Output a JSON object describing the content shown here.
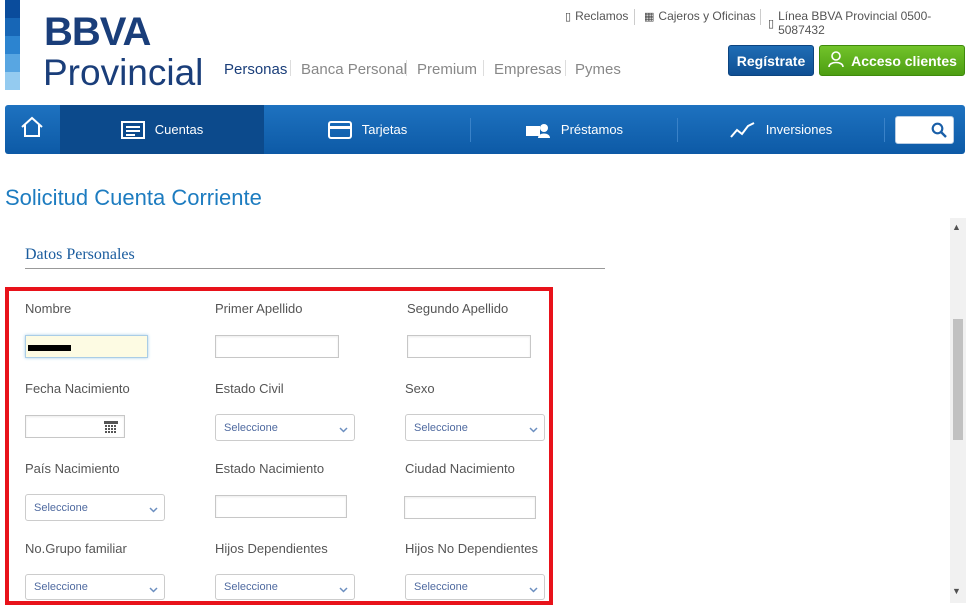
{
  "logo": {
    "line1": "BBVA",
    "line2": "Provincial",
    "stripe_colors": [
      "#0a4c9c",
      "#1766b6",
      "#2c84d0",
      "#58a6e2",
      "#94cbf0"
    ]
  },
  "utility_links": [
    {
      "label": "Reclamos",
      "icon": "phone-icon"
    },
    {
      "label": "Cajeros y Oficinas",
      "icon": "atm-icon"
    },
    {
      "label": "Línea BBVA Provincial 0500-5087432",
      "icon": "phone-icon"
    }
  ],
  "segments": [
    "Personas",
    "Banca Personal",
    "Premium",
    "Empresas",
    "Pymes"
  ],
  "buttons": {
    "register": "Regístrate",
    "client_access": "Acceso clientes"
  },
  "nav": {
    "items": [
      {
        "label": "Cuentas",
        "icon": "accounts-icon",
        "active": true
      },
      {
        "label": "Tarjetas",
        "icon": "card-icon"
      },
      {
        "label": "Préstamos",
        "icon": "loan-icon"
      },
      {
        "label": "Inversiones",
        "icon": "chart-line-icon"
      }
    ],
    "search_value": ""
  },
  "page_title": "Solicitud Cuenta Corriente",
  "section_title": "Datos Personales",
  "form": {
    "labels": {
      "nombre": "Nombre",
      "primer_apellido": "Primer Apellido",
      "segundo_apellido": "Segundo Apellido",
      "fecha_nacimiento": "Fecha Nacimiento",
      "estado_civil": "Estado Civil",
      "sexo": "Sexo",
      "pais_nacimiento": "País Nacimiento",
      "estado_nacimiento": "Estado Nacimiento",
      "ciudad_nacimiento": "Ciudad Nacimiento",
      "grupo_familiar": "No.Grupo familiar",
      "hijos_dependientes": "Hijos Dependientes",
      "hijos_no_dependientes": "Hijos No Dependientes"
    },
    "select_placeholder": "Seleccione"
  },
  "colors": {
    "accent_blue": "#1d7cc0",
    "nav_blue": "#0d5aa6",
    "green": "#5cb31c",
    "highlight_red": "#e8121a"
  }
}
